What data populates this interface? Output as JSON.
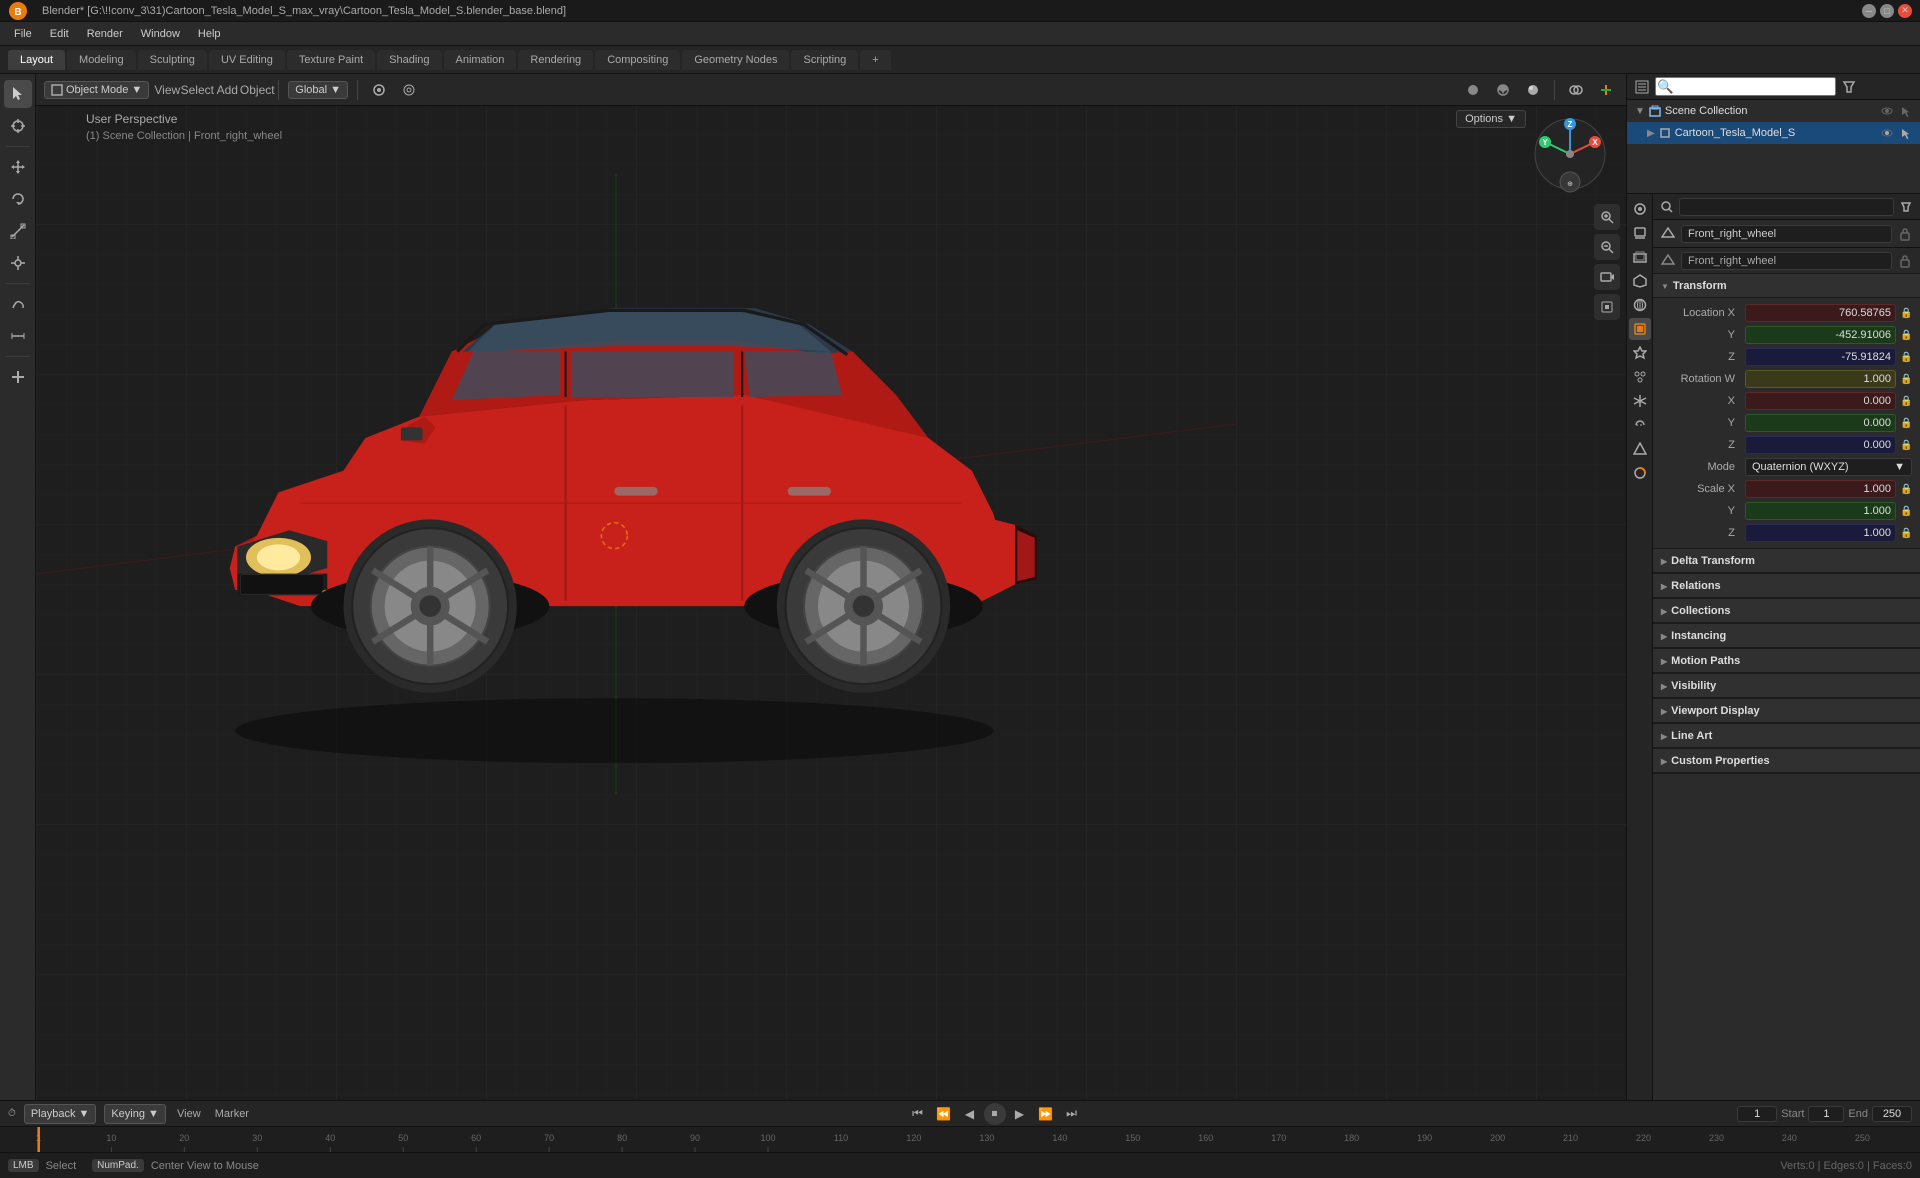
{
  "window": {
    "title": "Blender* [G:\\!!conv_3\\31)Cartoon_Tesla_Model_S_max_vray\\Cartoon_Tesla_Model_S.blender_base.blend]"
  },
  "menubar": {
    "items": [
      "File",
      "Edit",
      "Render",
      "Window",
      "Help"
    ]
  },
  "workspace_tabs": {
    "tabs": [
      "Layout",
      "Modeling",
      "Sculpting",
      "UV Editing",
      "Texture Paint",
      "Shading",
      "Animation",
      "Rendering",
      "Compositing",
      "Geometry Nodes",
      "Scripting"
    ],
    "active": "Layout",
    "plus": "+"
  },
  "viewport": {
    "mode_label": "Object Mode",
    "view_label": "View",
    "select_label": "Select",
    "add_label": "Add",
    "object_label": "Object",
    "global_label": "Global",
    "perspective_info": "User Perspective",
    "collection_info": "(1) Scene Collection | Front_right_wheel",
    "options_label": "Options"
  },
  "outliner": {
    "scene_collection": "Scene Collection",
    "item": "Cartoon_Tesla_Model_S"
  },
  "properties": {
    "object_name": "Front_right_wheel",
    "data_name": "Front_right_wheel",
    "transform": {
      "label": "Transform",
      "location_label": "Location X",
      "loc_x": "760.58765",
      "loc_y": "-452.91006",
      "loc_z": "-75.91824",
      "rotation_label": "Rotation W",
      "rot_w": "1.000",
      "rot_x": "0.000",
      "rot_y": "0.000",
      "rot_z": "0.000",
      "mode_label": "Mode",
      "mode_value": "Quaternion (WXYZ)",
      "scale_label": "Scale X",
      "scale_x": "1.000",
      "scale_y": "1.000",
      "scale_z": "1.000"
    },
    "sections": [
      {
        "label": "Delta Transform",
        "collapsed": true
      },
      {
        "label": "Relations",
        "collapsed": true
      },
      {
        "label": "Collections",
        "collapsed": true
      },
      {
        "label": "Instancing",
        "collapsed": true
      },
      {
        "label": "Motion Paths",
        "collapsed": true
      },
      {
        "label": "Visibility",
        "collapsed": true
      },
      {
        "label": "Viewport Display",
        "collapsed": true
      },
      {
        "label": "Line Art",
        "collapsed": true
      },
      {
        "label": "Custom Properties",
        "collapsed": true
      }
    ]
  },
  "timeline": {
    "playback_label": "Playback",
    "keying_label": "Keying",
    "view_label": "View",
    "marker_label": "Marker",
    "frame_current": "1",
    "start_label": "Start",
    "start_frame": "1",
    "end_label": "End",
    "end_frame": "250",
    "markers": [
      "1",
      "10",
      "20",
      "30",
      "40",
      "50",
      "60",
      "70",
      "80",
      "90",
      "100",
      "110",
      "120",
      "130",
      "140",
      "150",
      "160",
      "170",
      "180",
      "190",
      "200",
      "210",
      "220",
      "230",
      "240",
      "250"
    ]
  },
  "status_bar": {
    "select_key": "Select",
    "center_view": "Center View to Mouse"
  },
  "icons": {
    "chevron_down": "▼",
    "chevron_right": "▶",
    "lock": "🔒",
    "search": "🔍",
    "cursor": "⊕",
    "move": "⊞",
    "rotate": "↻",
    "scale": "⤡",
    "transform": "⊠",
    "annotate": "✏",
    "measure": "📏",
    "add": "+",
    "eye": "👁",
    "camera": "📷",
    "sun": "☀",
    "scene": "🎬",
    "world": "🌐",
    "object": "⬛",
    "mesh": "△",
    "material": "●",
    "particles": "⋮",
    "physics": "⚡",
    "constraints": "🔗",
    "modifier": "🔧",
    "object_data": "◉"
  }
}
